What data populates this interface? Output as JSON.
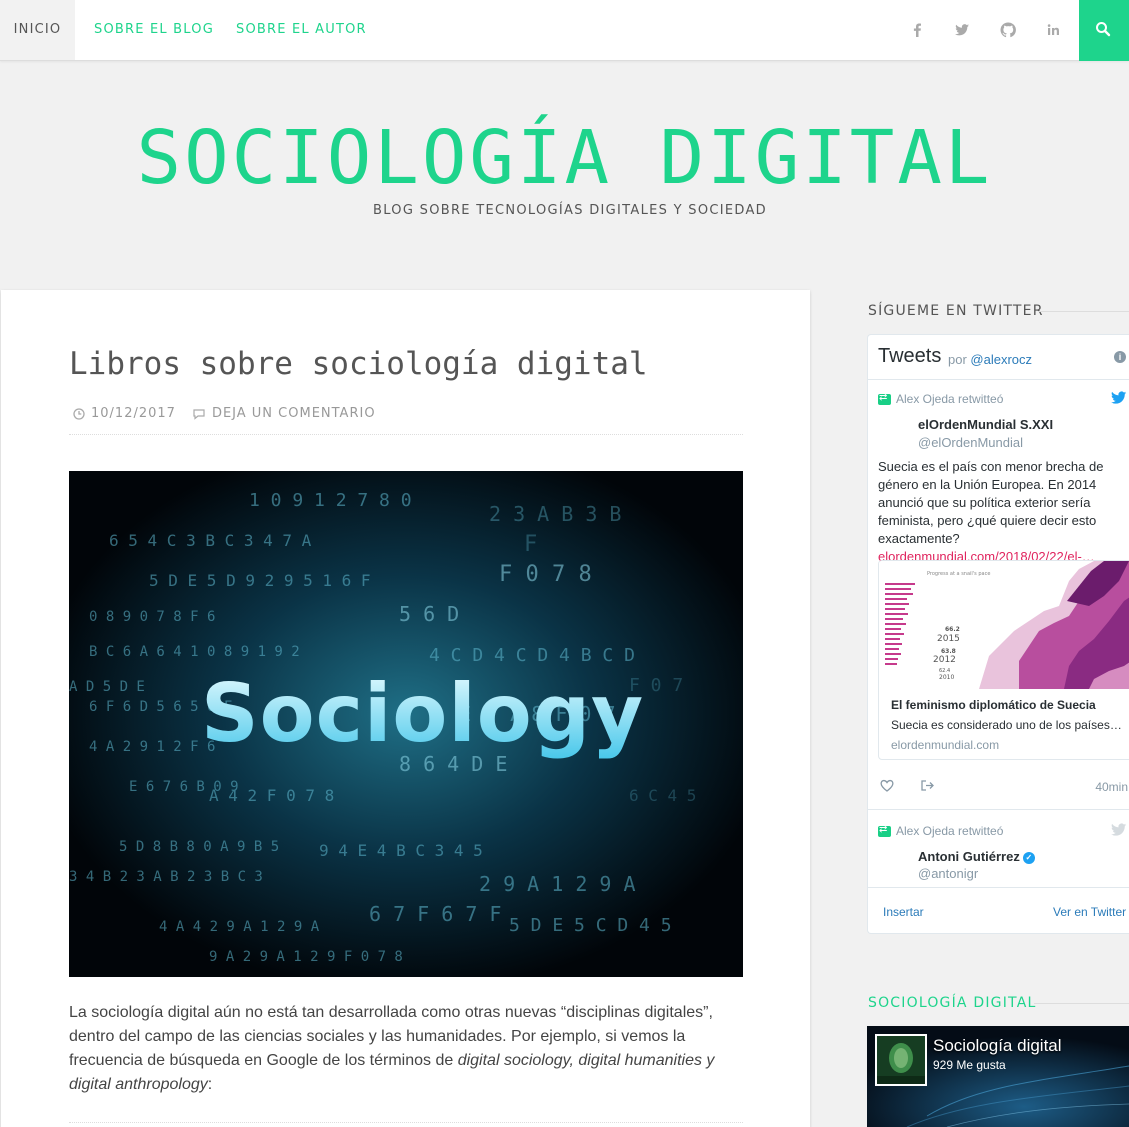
{
  "nav": {
    "items": [
      "INICIO",
      "SOBRE EL BLOG",
      "SOBRE EL AUTOR"
    ],
    "social_icons": [
      "facebook-icon",
      "twitter-icon",
      "github-icon",
      "linkedin-icon"
    ],
    "accent": "#1ed48c"
  },
  "header": {
    "title": "SOCIOLOGÍA DIGITAL",
    "tagline": "BLOG SOBRE TECNOLOGÍAS DIGITALES Y SOCIEDAD"
  },
  "post": {
    "title": "Libros sobre sociología digital",
    "date": "10/12/2017",
    "comments": "DEJA UN COMENTARIO",
    "image_text": "Sociology",
    "body_1": "La sociología digital aún no está tan desarrollada como otras nuevas “disciplinas digitales”, dentro del campo de las ciencias sociales y las humanidades. Por ejemplo, si vemos la frecuencia de búsqueda en Google de los términos de ",
    "body_em": "digital sociology, digital humanities y digital anthropology",
    "body_2": ":"
  },
  "sidebar": {
    "twitter_title": "SÍGUEME EN TWITTER",
    "twitter": {
      "heading": "Tweets",
      "by": "por",
      "account": "@alexrocz",
      "tweets": [
        {
          "retweeted_by": "Alex Ojeda retwitteó",
          "name": "elOrdenMundial S.XXI",
          "handle": "@elOrdenMundial",
          "text": "Suecia es el país con menor brecha de género en la Unión Europea. En 2014 anunció que su política exterior sería feminista, pero ¿qué quiere decir esto exactamente?",
          "link": "elordenmundial.com/2018/02/22/el-…",
          "card_title": "El feminismo diplomático de Suecia",
          "card_desc": "Suecia es considerado uno de los países…",
          "card_domain": "elordenmundial.com",
          "card_chart_caption": "Progress at a snail's pace",
          "card_values": [
            "66.2",
            "2015",
            "63.8",
            "2012",
            "62.4",
            "2010"
          ],
          "time": "40min"
        },
        {
          "retweeted_by": "Alex Ojeda retwitteó",
          "name": "Antoni Gutiérrez",
          "handle": "@antonigr"
        }
      ],
      "embed": "Insertar",
      "view": "Ver en Twitter"
    },
    "fb_title": "SOCIOLOGÍA DIGITAL",
    "facebook": {
      "page_name": "Sociología digital",
      "likes": "929 Me gusta"
    }
  }
}
